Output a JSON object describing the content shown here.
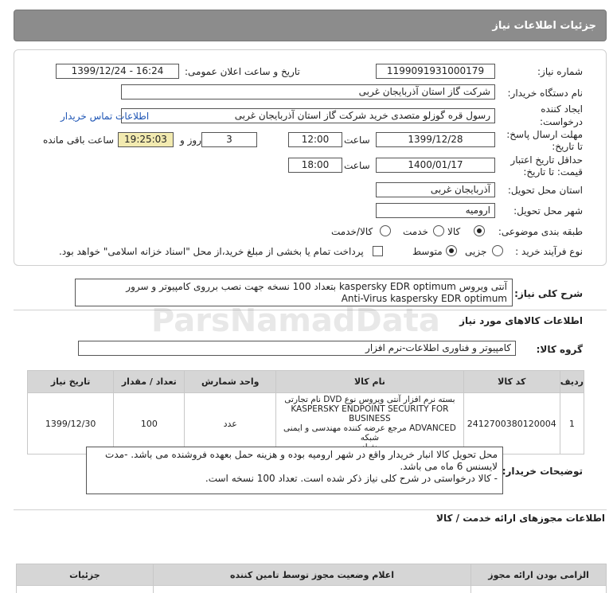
{
  "page": {
    "title": "جزئیات اطلاعات نیاز"
  },
  "details": {
    "need_number_label": "شماره نیاز:",
    "need_number": "1199091931000179",
    "announce_label": "تاریخ و ساعت اعلان عمومی:",
    "announce_value": "1399/12/24 - 16:24",
    "buyer_org_label": "نام دستگاه خریدار:",
    "buyer_org": "شرکت گاز استان آذربایجان غربی",
    "creator_label": "ایجاد کننده درخواست:",
    "creator": "رسول قره گوزلو متصدی خرید شرکت گاز استان آذربایجان غربی",
    "contact_link": "اطلاعات تماس خریدار",
    "deadline_label": "مهلت ارسال پاسخ: تا تاریخ:",
    "deadline_date": "1399/12/28",
    "time_label": "ساعت",
    "deadline_time": "12:00",
    "days_value": "3",
    "days_label": "روز و",
    "remaining_time": "19:25:03",
    "remaining_label": "ساعت باقی مانده",
    "validity_label": "حداقل تاریخ اعتبار قیمت: تا تاریخ:",
    "validity_date": "1400/01/17",
    "validity_time": "18:00",
    "province_label": "استان محل تحویل:",
    "province": "آذربایجان غربی",
    "city_label": "شهر محل تحویل:",
    "city": "ارومیه",
    "category_label": "طبقه بندی موضوعی:",
    "category_options": [
      "کالا",
      "خدمت",
      "کالا/خدمت"
    ],
    "purchase_type_label": "نوع فرآیند خرید :",
    "purchase_options": [
      "جزیی",
      "متوسط"
    ],
    "payment_note": "پرداخت تمام یا بخشی از مبلغ خرید،از محل \"اسناد خزانه اسلامی\" خواهد بود."
  },
  "general_description": {
    "label": "شرح کلی نیاز:",
    "line1": "آنتی ویروس kaspersky EDR optimum  بتعداد 100 نسخه جهت نصب برروی کامپیوتر و سرور",
    "line2": "Anti-Virus kaspersky EDR optimum"
  },
  "goods_section": {
    "title": "اطلاعات کالاهای مورد نیاز",
    "group_label": "گروه کالا:",
    "group_value": "کامپیوتر و فناوری اطلاعات-نرم افزار"
  },
  "items_table": {
    "headers": [
      "ردیف",
      "کد کالا",
      "نام کالا",
      "واحد شمارش",
      "تعداد / مقدار",
      "تاریخ نیاز"
    ],
    "rows": [
      {
        "index": "1",
        "code": "2412700380120004",
        "name_l1": "بسته نرم افزار آنتی ویروس نوع DVD نام تجارتی",
        "name_l2": "KASPERSKY ENDPOINT SECURITY FOR BUSINESS",
        "name_l3": "ADVANCED مرجع عرضه کننده مهندسی و ایمنی شبکه",
        "name_l4": "دژپاد",
        "unit": "عدد",
        "quantity": "100",
        "date": "1399/12/30"
      }
    ]
  },
  "buyer_notes": {
    "label": "توضیحات خریدار:",
    "line1": "محل تحویل کالا انبار خریدار واقع در شهر ارومیه بوده و هزینه حمل بعهده فروشنده می باشد. -مدت",
    "line2": "لایسنس 6 ماه می باشد.",
    "line3": "- کالا درخواستی در شرح کلی نیاز ذکر شده است. تعداد 100 نسخه است."
  },
  "license_section": {
    "title": "اطلاعات مجوزهای ارائه خدمت / کالا",
    "headers": [
      "الزامی بودن ارائه مجوز",
      "اعلام وضعیت مجوز توسط تامین کننده",
      "جزئیات"
    ]
  },
  "watermark": {
    "brand": "ParsNamadData"
  }
}
